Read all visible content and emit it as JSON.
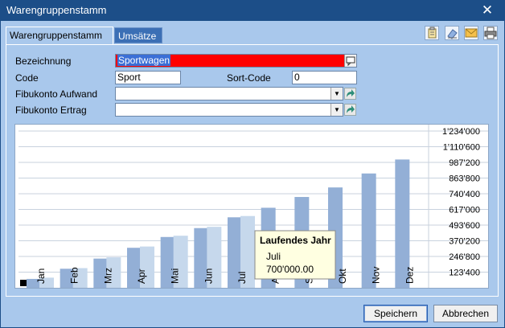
{
  "window": {
    "title": "Warengruppenstamm",
    "close_glyph": "✕"
  },
  "tabs": [
    {
      "label": "Warengruppenstamm"
    },
    {
      "label": "Umsätze"
    }
  ],
  "toolbar": {
    "icons": [
      "clipboard-icon",
      "eraser-icon",
      "mail-icon",
      "print-icon"
    ]
  },
  "form": {
    "bezeichnung_label": "Bezeichnung",
    "bezeichnung_value": "Sportwagen",
    "code_label": "Code",
    "code_value": "Sport",
    "sortcode_label": "Sort-Code",
    "sortcode_value": "0",
    "aufwand_label": "Fibukonto Aufwand",
    "aufwand_value": "",
    "ertrag_label": "Fibukonto Ertrag",
    "ertrag_value": ""
  },
  "chart_data": {
    "type": "bar",
    "categories": [
      "Jan",
      "Feb",
      "Mrz",
      "Apr",
      "Mai",
      "Jun",
      "Jul",
      "Aug",
      "Sep",
      "Okt",
      "Nov",
      "Dez"
    ],
    "series": [
      {
        "values": [
          70000,
          150000,
          230000,
          315000,
          400000,
          470000,
          555000,
          630000,
          715000,
          790000,
          900000,
          1010000
        ]
      },
      {
        "values": [
          80000,
          155000,
          240000,
          325000,
          410000,
          480000,
          565000
        ]
      }
    ],
    "y_ticks": [
      "123'400",
      "246'800",
      "370'200",
      "493'600",
      "617'000",
      "740'400",
      "863'800",
      "987'200",
      "1'110'600",
      "1'234'000"
    ],
    "ylim": [
      0,
      1234000
    ],
    "grid": true,
    "colors": {
      "series0": "#93afd6",
      "series1": "#c6d8ec"
    },
    "tooltip": {
      "title": "Laufendes Jahr",
      "line1": "Juli",
      "line2": "700'000.00"
    }
  },
  "buttons": {
    "save": "Speichern",
    "cancel": "Abbrechen"
  },
  "colors": {
    "accent": "#1c4e88",
    "client": "#a9c8ec",
    "highlight": "#ff0000"
  }
}
